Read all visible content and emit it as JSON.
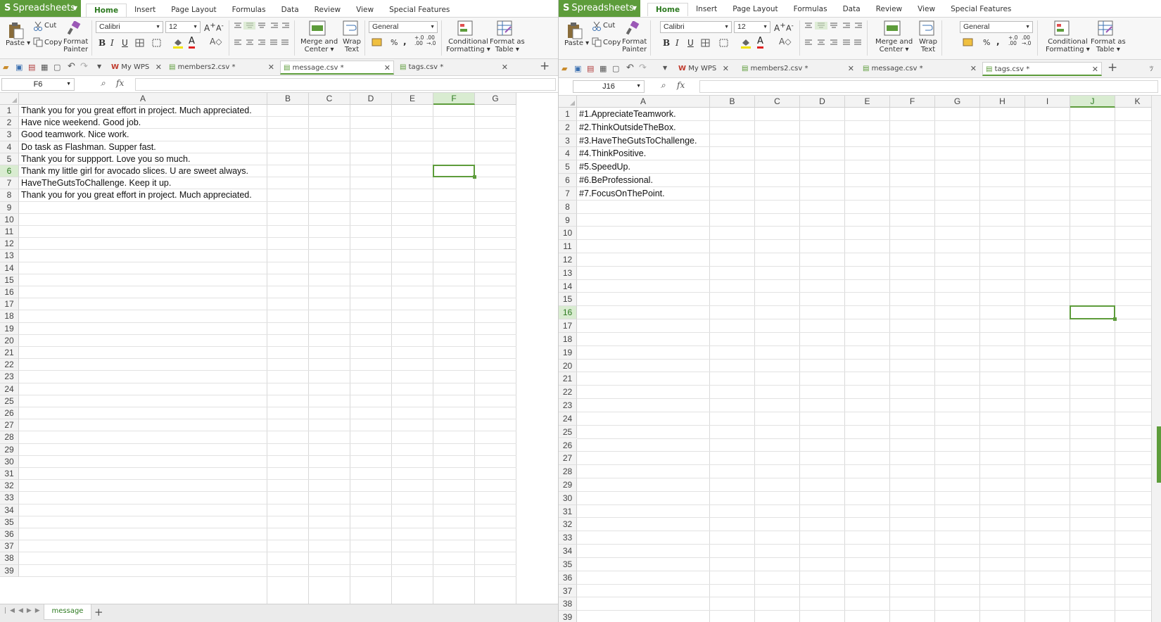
{
  "app": {
    "name": "Spreadsheets"
  },
  "menu_tabs": [
    "Home",
    "Insert",
    "Page Layout",
    "Formulas",
    "Data",
    "Review",
    "View",
    "Special Features"
  ],
  "ribbon": {
    "paste": "Paste",
    "cut": "Cut",
    "copy": "Copy",
    "format_painter_1": "Format",
    "format_painter_2": "Painter",
    "font_name": "Calibri",
    "font_size": "12",
    "bold": "B",
    "italic": "I",
    "underline": "U",
    "merge_1": "Merge and",
    "merge_2": "Center",
    "wrap_1": "Wrap",
    "wrap_2": "Text",
    "number_format": "General",
    "percent": "%",
    "thousands": ",",
    "cond_1": "Conditional",
    "cond_2": "Formatting",
    "fmt_table_1": "Format as",
    "fmt_table_2": "Table"
  },
  "doc_tabs": [
    "My WPS",
    "members2.csv *",
    "message.csv *",
    "tags.csv *"
  ],
  "left": {
    "name_box": "F6",
    "active_tab_index": 2,
    "columns": [
      "A",
      "B",
      "C",
      "D",
      "E",
      "F",
      "G"
    ],
    "selected_col": "F",
    "selected_row": 6,
    "rows": [
      "1",
      "2",
      "3",
      "4",
      "5",
      "6",
      "7",
      "8",
      "9",
      "10",
      "11",
      "12",
      "13",
      "14",
      "15",
      "16",
      "17",
      "18",
      "19",
      "20",
      "21",
      "22",
      "23",
      "24",
      "25",
      "26",
      "27",
      "28",
      "29",
      "30",
      "31",
      "32",
      "33",
      "34",
      "35",
      "36",
      "37",
      "38",
      "39"
    ],
    "cells_a": [
      "Thank you for you great effort in project. Much appreciated.",
      "Have nice weekend. Good job.",
      "Good teamwork. Nice work.",
      "Do task as Flashman. Supper fast.",
      "Thank you for suppport. Love you so much.",
      "Thank my little girl for avocado slices. U are sweet always.",
      "HaveTheGutsToChallenge. Keep it up.",
      "Thank you for you great effort in project. Much appreciated."
    ],
    "sheet_tab": "message"
  },
  "right": {
    "name_box": "J16",
    "active_tab_index": 3,
    "columns": [
      "A",
      "B",
      "C",
      "D",
      "E",
      "F",
      "G",
      "H",
      "I",
      "J",
      "K"
    ],
    "selected_col": "J",
    "selected_row": 16,
    "rows": [
      "1",
      "2",
      "3",
      "4",
      "5",
      "6",
      "7",
      "8",
      "9",
      "10",
      "11",
      "12",
      "13",
      "14",
      "15",
      "16",
      "17",
      "18",
      "19",
      "20",
      "21",
      "22",
      "23",
      "24",
      "25",
      "26",
      "27",
      "28",
      "29",
      "30",
      "31",
      "32",
      "33",
      "34",
      "35",
      "36",
      "37",
      "38",
      "39"
    ],
    "cells_a": [
      "#1.AppreciateTeamwork.",
      "#2.ThinkOutsideTheBox.",
      "#3.HaveTheGutsToChallenge.",
      "#4.ThinkPositive.",
      "#5.SpeedUp.",
      "#6.BeProfessional.",
      "#7.FocusOnThePoint."
    ]
  },
  "colors": {
    "accent": "#5d9c3b"
  }
}
